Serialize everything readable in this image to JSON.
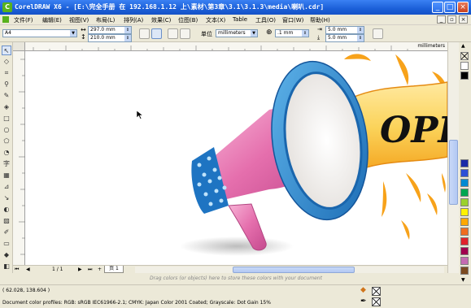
{
  "window": {
    "title": "CorelDRAW X6 - [E:\\完全手册 在 192.168.1.12 上\\素材\\第3章\\3.1\\3.1.3\\media\\喇叭.cdr]",
    "minimize_glyph": "_",
    "maximize_glyph": "□",
    "close_glyph": "×",
    "app_icon_glyph": "C"
  },
  "menu": {
    "items": [
      "文件(F)",
      "编辑(E)",
      "视图(V)",
      "布局(L)",
      "排列(A)",
      "效果(C)",
      "位图(B)",
      "文本(X)",
      "Table",
      "工具(O)",
      "窗口(W)",
      "帮助(H)"
    ],
    "mdi_min": "_",
    "mdi_restore": "▫",
    "mdi_close": "×"
  },
  "property_bar": {
    "page_size": "A4",
    "width": "297.0 mm",
    "height": "210.0 mm",
    "units_label": "单位",
    "units": "millimeters",
    "nudge": ".1 mm",
    "dup_x": "5.0 mm",
    "dup_y": "5.0 mm"
  },
  "ruler": {
    "unit": "millimeters"
  },
  "toolbox": {
    "tools": [
      {
        "name": "pick-tool",
        "glyph": "↖"
      },
      {
        "name": "shape-tool",
        "glyph": "◇"
      },
      {
        "name": "crop-tool",
        "glyph": "⌗"
      },
      {
        "name": "zoom-tool",
        "glyph": "⚲"
      },
      {
        "name": "freehand-tool",
        "glyph": "✎"
      },
      {
        "name": "smart-fill-tool",
        "glyph": "◈"
      },
      {
        "name": "rectangle-tool",
        "glyph": "□"
      },
      {
        "name": "ellipse-tool",
        "glyph": "○"
      },
      {
        "name": "polygon-tool",
        "glyph": "⬠"
      },
      {
        "name": "basic-shapes-tool",
        "glyph": "◔"
      },
      {
        "name": "text-tool",
        "glyph": "字"
      },
      {
        "name": "table-tool",
        "glyph": "▦"
      },
      {
        "name": "dimension-tool",
        "glyph": "⊿"
      },
      {
        "name": "connector-tool",
        "glyph": "↘"
      },
      {
        "name": "blend-tool",
        "glyph": "◐"
      },
      {
        "name": "transparency-tool",
        "glyph": "▨"
      },
      {
        "name": "eyedropper-tool",
        "glyph": "✐"
      },
      {
        "name": "outline-tool",
        "glyph": "▭"
      },
      {
        "name": "fill-tool",
        "glyph": "◆"
      },
      {
        "name": "interactive-fill-tool",
        "glyph": "◧"
      }
    ]
  },
  "canvas": {
    "banner_text": "OPE"
  },
  "palette": {
    "colors": [
      "#ffffff",
      "#000000",
      "#1a2aa8",
      "#2d4fd6",
      "#008ad2",
      "#00a650",
      "#9bd12d",
      "#fff200",
      "#ffa800",
      "#f06d1f",
      "#e0222b",
      "#a0004e",
      "#c46bb2",
      "#7b4a21"
    ]
  },
  "page_nav": {
    "first": "⏮",
    "prev": "◀",
    "page_count": "1 / 1",
    "next": "▶",
    "last": "⏭",
    "add_page": "+",
    "page_tab": "页 1"
  },
  "hint": "Drag colors (or objects) here to store these colors with your document",
  "status": {
    "coords": "( 62.028, 138.604 )",
    "profile": "Document color profiles: RGB: sRGB IEC61966-2.1; CMYK: Japan Color 2001 Coated; Grayscale: Dot Gain 15%"
  }
}
